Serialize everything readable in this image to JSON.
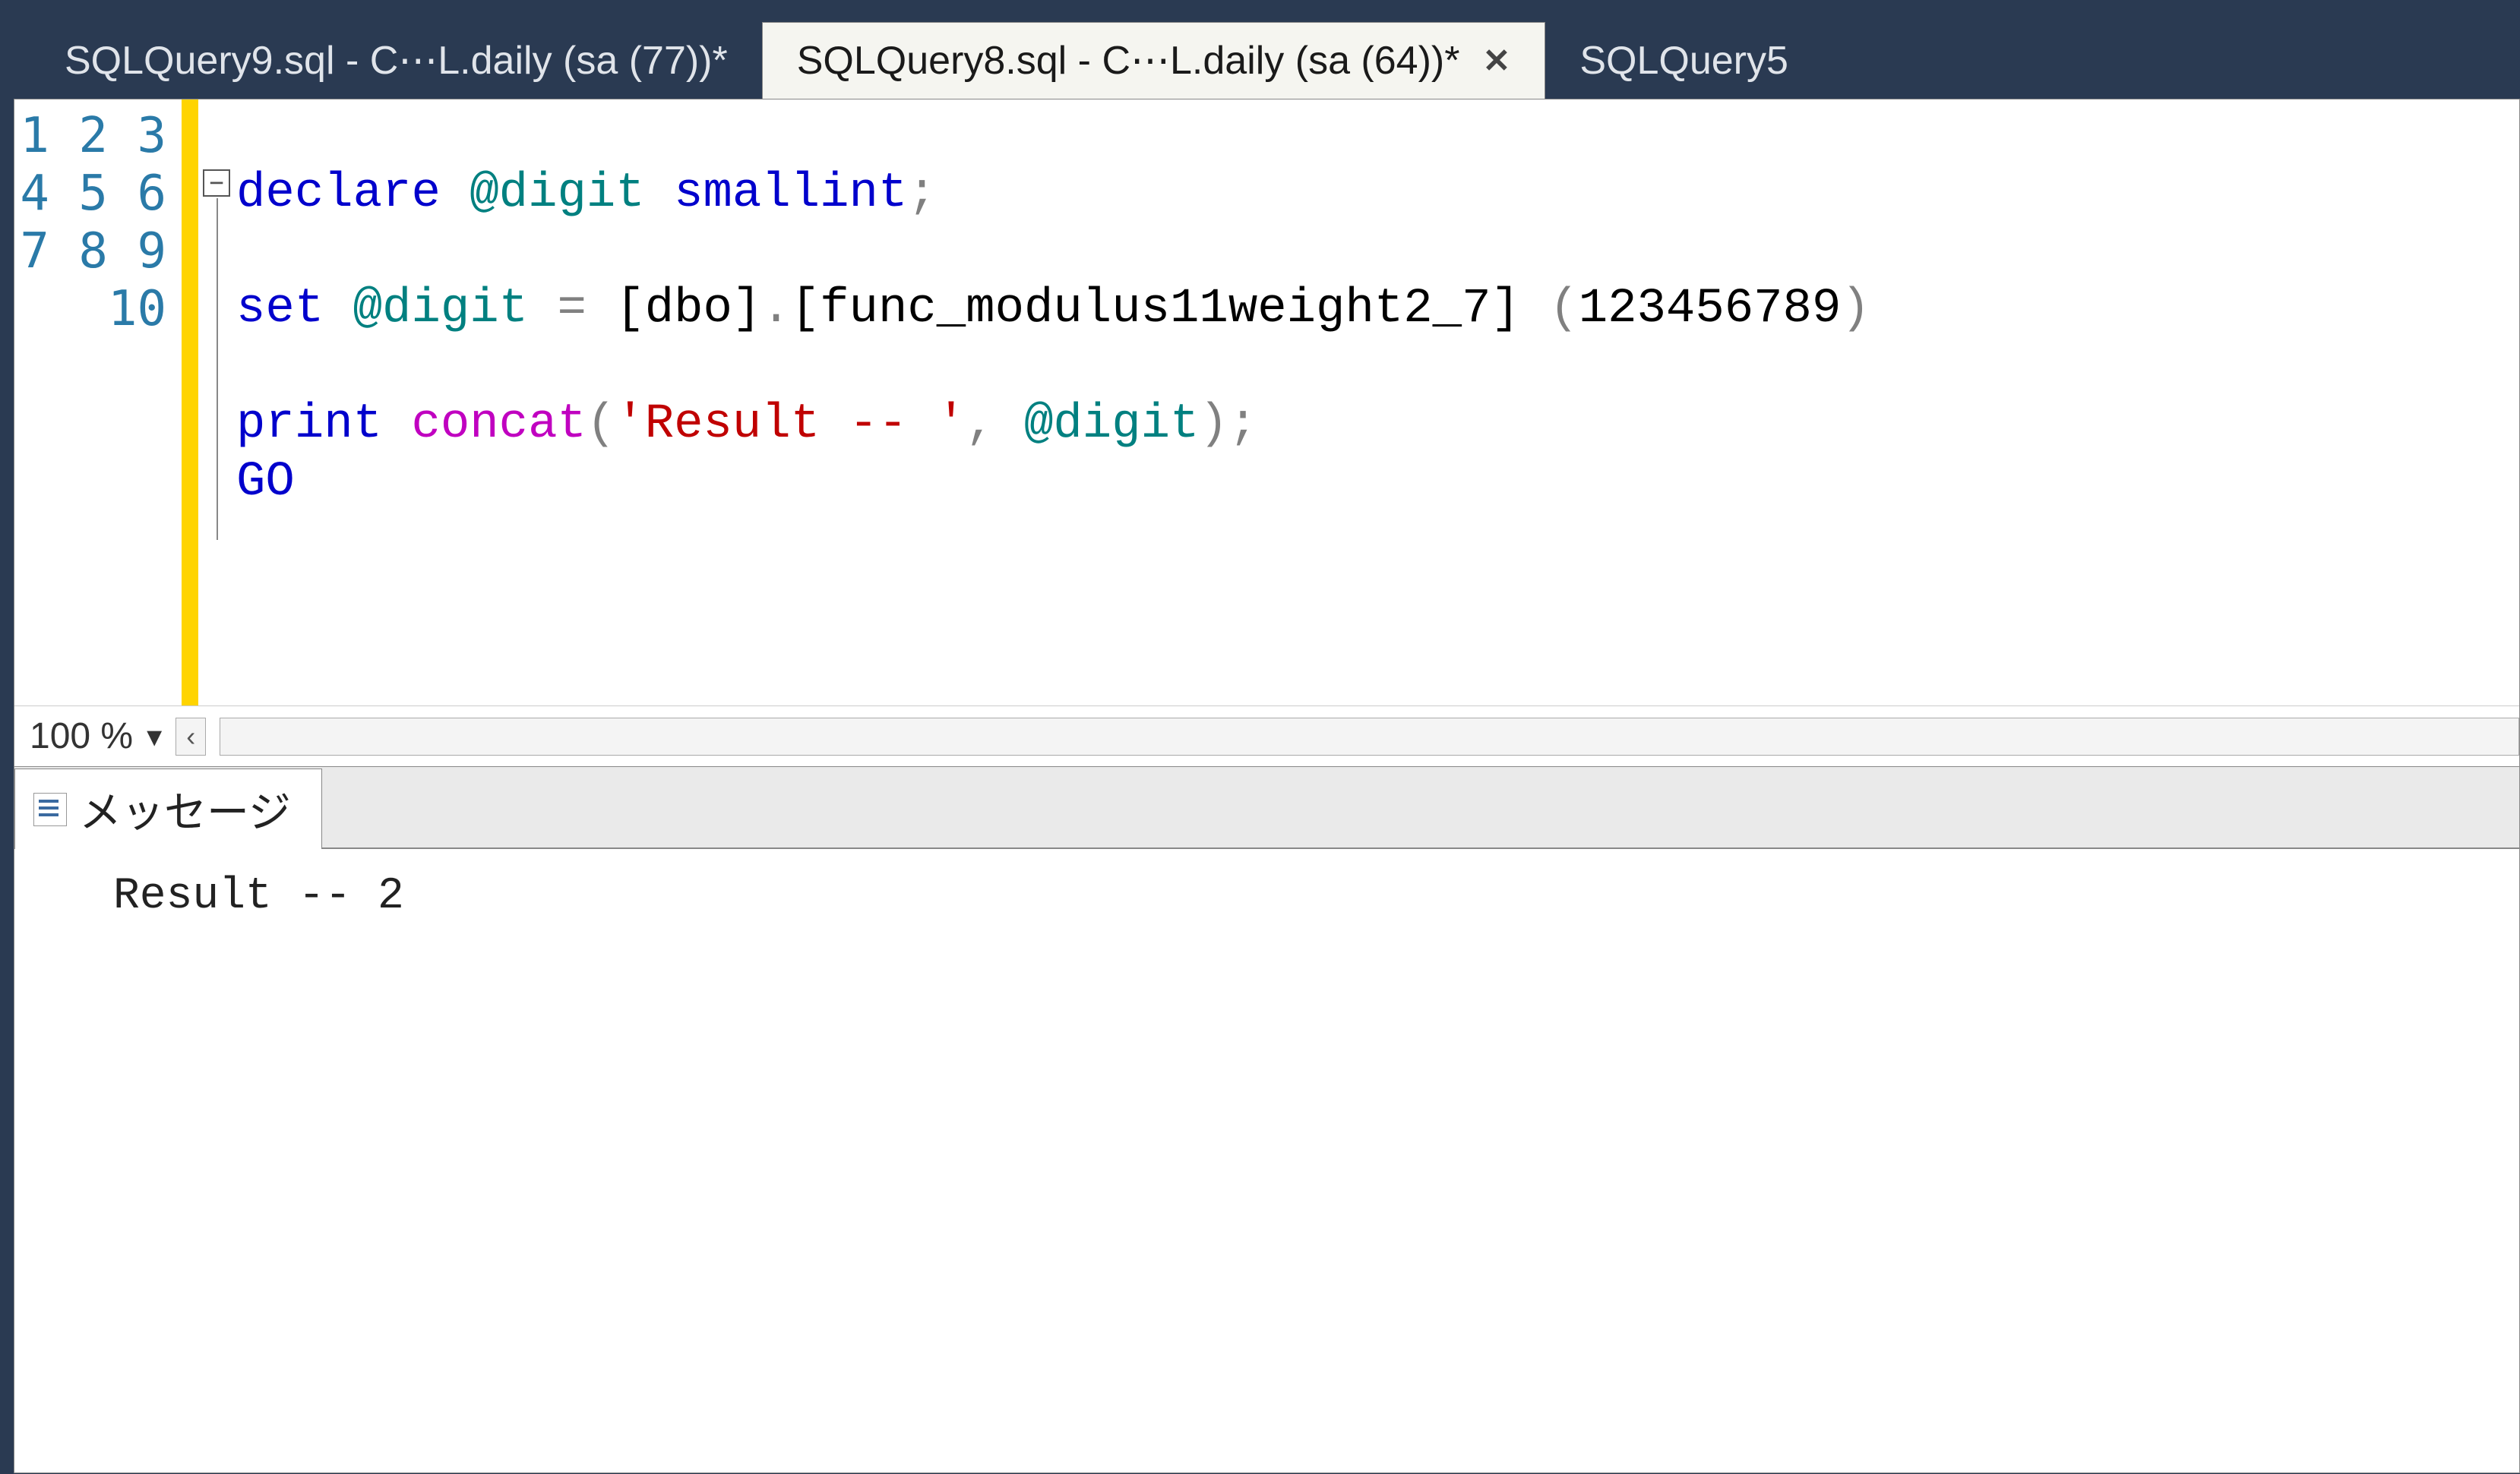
{
  "tabs": [
    {
      "label": "SQLQuery9.sql - C⋯L.daily (sa (77))*",
      "active": false
    },
    {
      "label": "SQLQuery8.sql - C⋯L.daily (sa (64))*",
      "active": true
    },
    {
      "label": "SQLQuery5",
      "active": false
    }
  ],
  "close_glyph": "✕",
  "gutter": {
    "start": 1,
    "end": 10
  },
  "fold_glyph": "−",
  "code_lines": [
    {
      "tokens": []
    },
    {
      "tokens": [
        {
          "t": "declare",
          "c": "kw-blue"
        },
        {
          "t": " ",
          "c": ""
        },
        {
          "t": "@digit",
          "c": "kw-teal"
        },
        {
          "t": " ",
          "c": ""
        },
        {
          "t": "smallint",
          "c": "kw-blue"
        },
        {
          "t": ";",
          "c": "kw-gray"
        }
      ]
    },
    {
      "tokens": []
    },
    {
      "tokens": [
        {
          "t": "set",
          "c": "kw-blue"
        },
        {
          "t": " ",
          "c": ""
        },
        {
          "t": "@digit",
          "c": "kw-teal"
        },
        {
          "t": " ",
          "c": ""
        },
        {
          "t": "=",
          "c": "kw-gray"
        },
        {
          "t": " [dbo]",
          "c": "kw-black"
        },
        {
          "t": ".",
          "c": "kw-gray"
        },
        {
          "t": "[func_modulus11weight2_7] ",
          "c": "kw-black"
        },
        {
          "t": "(",
          "c": "kw-gray"
        },
        {
          "t": "123456789",
          "c": "kw-black"
        },
        {
          "t": ")",
          "c": "kw-gray"
        }
      ]
    },
    {
      "tokens": []
    },
    {
      "tokens": [
        {
          "t": "print",
          "c": "kw-blue"
        },
        {
          "t": " ",
          "c": ""
        },
        {
          "t": "concat",
          "c": "kw-magenta"
        },
        {
          "t": "(",
          "c": "kw-gray"
        },
        {
          "t": "'Result -- '",
          "c": "kw-redstr"
        },
        {
          "t": ",",
          "c": "kw-gray"
        },
        {
          "t": " ",
          "c": ""
        },
        {
          "t": "@digit",
          "c": "kw-teal"
        },
        {
          "t": ");",
          "c": "kw-gray"
        }
      ]
    },
    {
      "tokens": [
        {
          "t": "GO",
          "c": "kw-blue"
        }
      ]
    },
    {
      "tokens": []
    },
    {
      "tokens": []
    },
    {
      "tokens": []
    }
  ],
  "zoom": {
    "value": "100 %",
    "dropdown_glyph": "▾",
    "scroll_left_glyph": "‹"
  },
  "results": {
    "tab_label": "メッセージ",
    "output": "Result -- 2"
  }
}
